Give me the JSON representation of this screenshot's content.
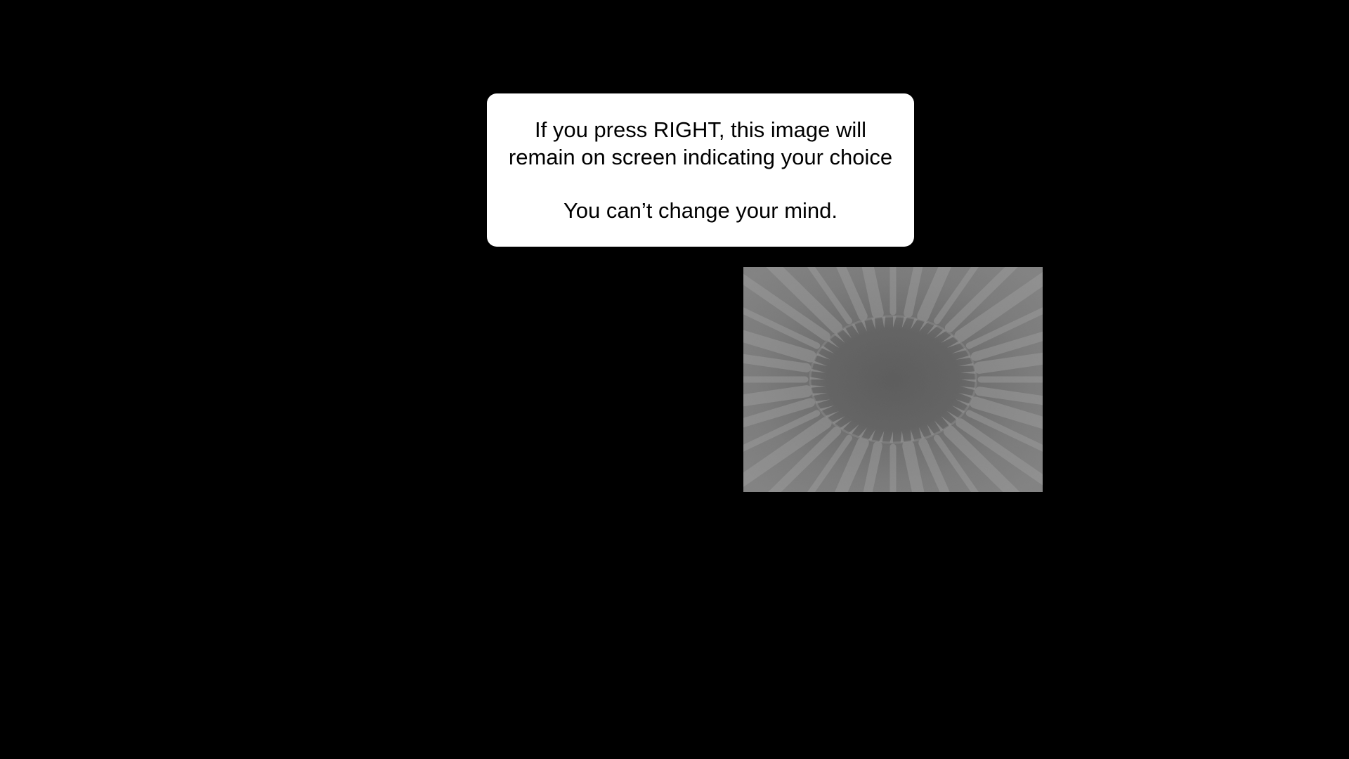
{
  "instruction": {
    "line1": "If you press RIGHT, this image will",
    "line2": "remain on screen indicating your choice",
    "line3": "You can’t change your mind."
  },
  "stimulus": {
    "icon": "radial-fractal-image",
    "colors": {
      "background": "#000000",
      "box": "#ffffff",
      "text": "#000000"
    }
  }
}
